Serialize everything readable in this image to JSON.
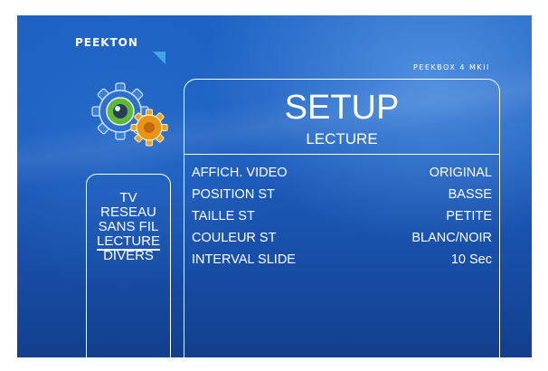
{
  "brand": "PEEKTON",
  "model": "PEEKBOX 4 MKII",
  "setup": {
    "title": "SETUP",
    "subtitle": "LECTURE"
  },
  "menu": {
    "items": [
      {
        "label": "TV",
        "selected": false
      },
      {
        "label": "RESEAU",
        "selected": false
      },
      {
        "label": "SANS FIL",
        "selected": false
      },
      {
        "label": "LECTURE",
        "selected": true
      },
      {
        "label": "DIVERS",
        "selected": false
      }
    ]
  },
  "settings": [
    {
      "label": "AFFICH. VIDEO",
      "value": "ORIGINAL"
    },
    {
      "label": "POSITION ST",
      "value": "BASSE"
    },
    {
      "label": "TAILLE ST",
      "value": "PETITE"
    },
    {
      "label": "COULEUR ST",
      "value": "BLANC/NOIR"
    },
    {
      "label": "INTERVAL SLIDE",
      "value": "10 Sec"
    }
  ],
  "icons": {
    "settings": "gear-icon"
  },
  "colors": {
    "background": "#1c5fc0",
    "text": "#ffffff",
    "gear_blue": "#2f6fd0",
    "gear_orange": "#f0a020",
    "gear_green": "#6cc24a"
  }
}
